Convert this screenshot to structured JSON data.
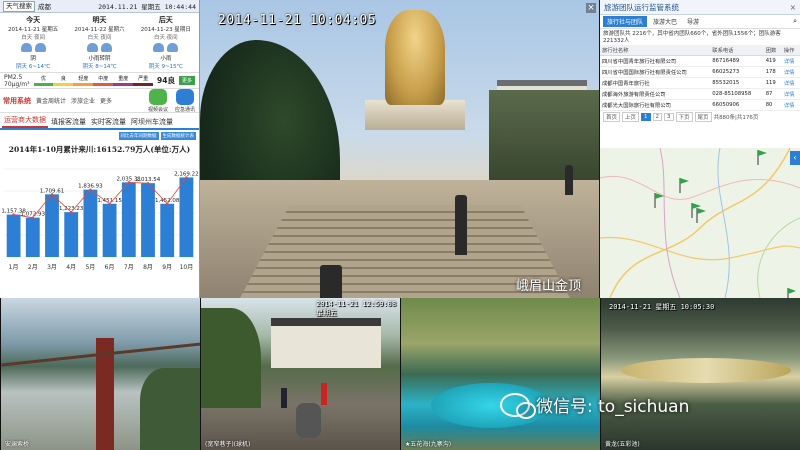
{
  "left": {
    "weather_chip": "天气搜索",
    "city": "成都",
    "datetime": "2014.11.21 星期五 10:44:44",
    "days": [
      {
        "name": "今天",
        "date": "2014-11-21 星期五",
        "dn": "白天  夜间",
        "cond": "阴",
        "temp": "阴天 6~14℃",
        "icon": "cloud"
      },
      {
        "name": "明天",
        "date": "2014-11-22 星期六",
        "dn": "白天  夜间",
        "cond": "小雨转阴",
        "temp": "阴天 8~14℃",
        "icon": "rain"
      },
      {
        "name": "后天",
        "date": "2014-11-23 星期日",
        "dn": "白天  夜间",
        "cond": "小雨",
        "temp": "阴天 9~15℃",
        "icon": "rain"
      }
    ],
    "pm": {
      "label": "PM2.5",
      "sublabel": "70μg/m³",
      "scale": [
        "优",
        "良",
        "轻度",
        "中度",
        "重度",
        "严重"
      ],
      "scale_colors": [
        "#4cae4c",
        "#f4d03f",
        "#f0a33a",
        "#e05a4a",
        "#9b3b8b",
        "#6b2a2a"
      ],
      "value": "94良",
      "button": "更多"
    },
    "nav": {
      "section": "常用系统",
      "items": [
        "黄金周统计",
        "涉旅企业",
        "更多"
      ],
      "buttons": [
        "视频会议",
        "应急通讯"
      ],
      "button_colors": [
        "#4db34a",
        "#2d7fd6"
      ]
    },
    "tabs": [
      "运营商大数据",
      "填报客流量",
      "实时客流量",
      "阿坝州车流量"
    ],
    "active_tab": 0,
    "chart_ctrl": [
      "同比去年同期数据",
      "生成数据统计表"
    ]
  },
  "chart_data": {
    "type": "bar",
    "title": "2014年1-10月累计来川:16152.79万人(单位:万人)",
    "categories": [
      "1月",
      "2月",
      "3月",
      "4月",
      "5月",
      "6月",
      "7月",
      "8月",
      "9月",
      "10月"
    ],
    "values": [
      1157.38,
      1072.93,
      1709.61,
      1223.23,
      1836.93,
      1451.15,
      2035.31,
      2013.54,
      1452.08,
      2169.22
    ],
    "value_labels": [
      "1,157.38",
      "1,072.93",
      "1,709.61",
      "1,223.23",
      "1,836.93",
      "1,451.15",
      "2,035.31",
      "2,013.54",
      "1,452.08",
      "2,169.22"
    ],
    "ylim": [
      0,
      2400
    ],
    "bar_color": "#2d7fd6",
    "line_color": "#e5483c"
  },
  "main_cam": {
    "timestamp": "2014-11-21  10:04:05",
    "watermark": "峨眉山金顶",
    "close": "×"
  },
  "right": {
    "title": "旅游团队运行监管系统",
    "close": "×",
    "tabs": [
      "旅行社与团队",
      "旅游大巴",
      "导游"
    ],
    "summary": "旅游团队共 2216个，其中省内团队660个，省外团队1556个；团队游客221332人",
    "columns": [
      "旅行社名称",
      "联系电话",
      "团数",
      "操作"
    ],
    "rows": [
      [
        "四川省中国青年旅行社有限公司",
        "86716489",
        "419",
        "详情"
      ],
      [
        "四川省中国国际旅行社有限责任公司",
        "66025273",
        "178",
        "详情"
      ],
      [
        "成都中国青年旅行社",
        "85532015",
        "119",
        "详情"
      ],
      [
        "成都海外旅游有限责任公司",
        "028-85108958",
        "87",
        "详情"
      ],
      [
        "成都光大国际旅行社有限公司",
        "66050906",
        "80",
        "详情"
      ]
    ],
    "pager": [
      "首页",
      "上页",
      "1",
      "2",
      "3",
      "下页",
      "尾页",
      "共880条|共176页"
    ],
    "map_arrow": "‹"
  },
  "bottom": {
    "cam1": {
      "ts": "",
      "label": "安澜索桥"
    },
    "cam2": {
      "ts": "2014-11-21 12:59:08 星期五",
      "label": "(宽窄巷子)(球机)"
    },
    "cam3": {
      "ts": "",
      "label": "★五花海(九寨沟)"
    },
    "cam4": {
      "ts": "2014-11-21  星期五  10:05:30",
      "label": "黄龙(五彩池)"
    }
  },
  "wechat": {
    "text": "微信号: to_sichuan"
  }
}
